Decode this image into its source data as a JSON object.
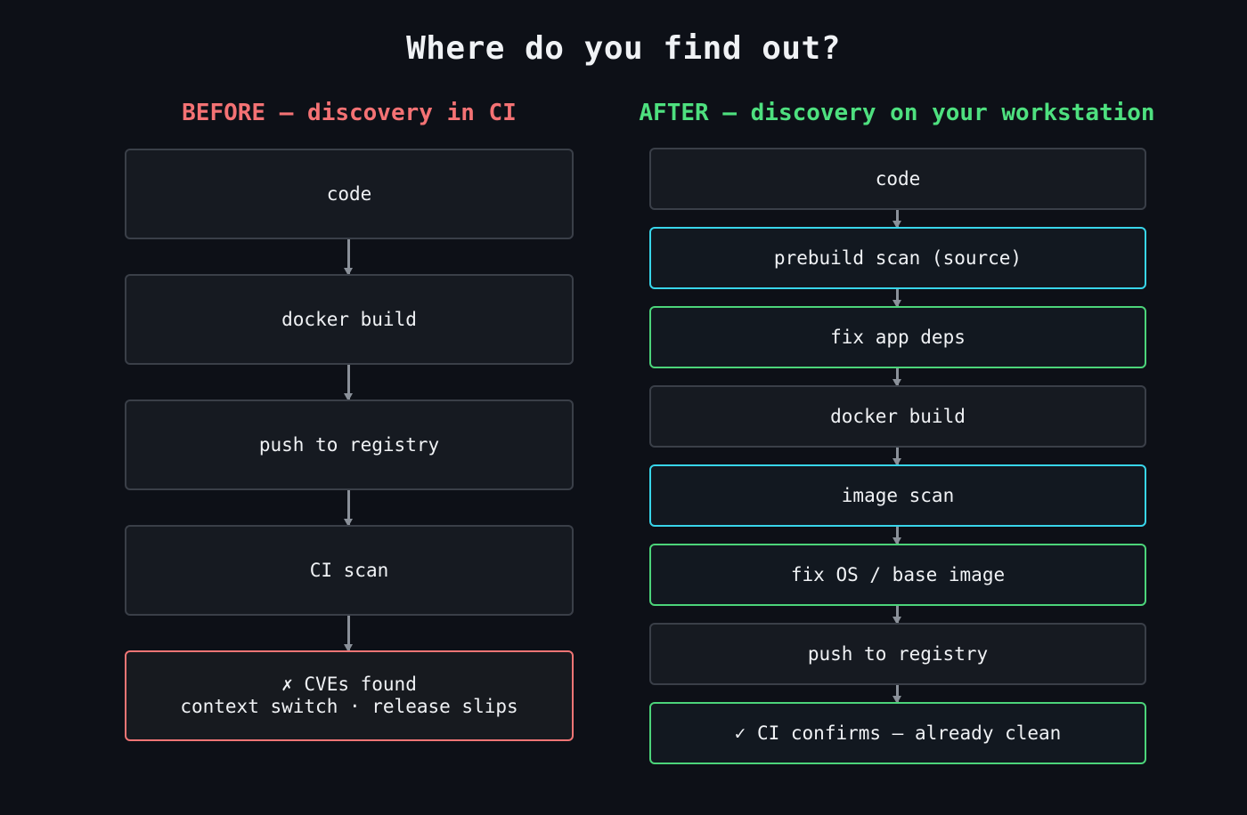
{
  "title": "Where do you find out?",
  "before": {
    "heading": "BEFORE — discovery in CI",
    "steps": [
      {
        "label": "code"
      },
      {
        "label": "docker build"
      },
      {
        "label": "push to registry"
      },
      {
        "label": "CI scan"
      },
      {
        "label": "✗ CVEs found\ncontext switch · release slips"
      }
    ]
  },
  "after": {
    "heading": "AFTER — discovery on your workstation",
    "steps": [
      {
        "label": "code"
      },
      {
        "label": "prebuild scan (source)"
      },
      {
        "label": "fix app deps"
      },
      {
        "label": "docker build"
      },
      {
        "label": "image scan"
      },
      {
        "label": "fix OS / base image"
      },
      {
        "label": "push to registry"
      },
      {
        "label": "✓ CI confirms — already clean"
      }
    ]
  },
  "colors": {
    "background": "#0d1017",
    "before_accent": "#f47274",
    "after_accent": "#4ee07f",
    "scan_border": "#38d5ea",
    "fix_border": "#4cd47a",
    "neutral_border": "#3a3f48",
    "arrow": "#8a9099"
  }
}
